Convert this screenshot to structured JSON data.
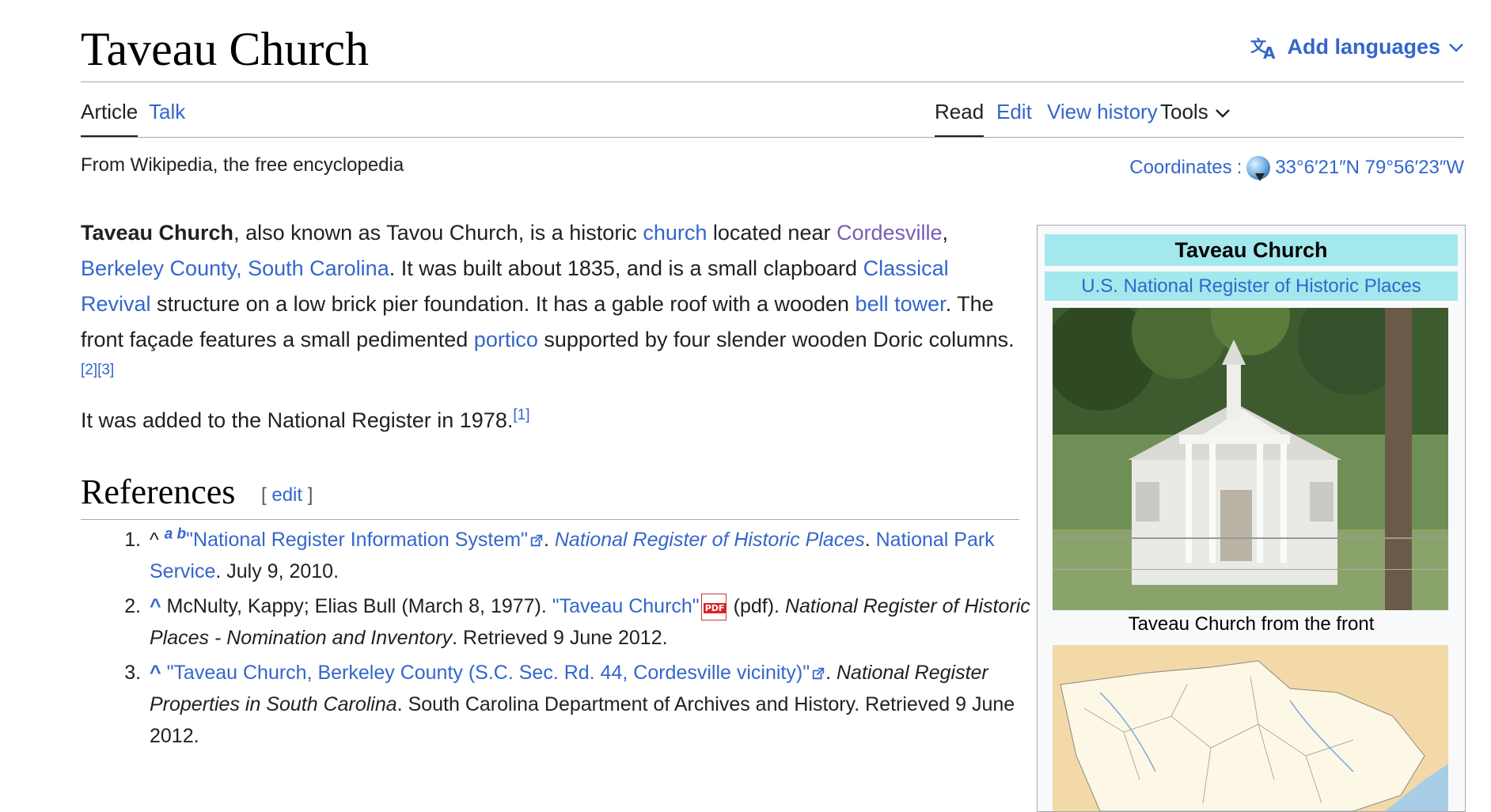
{
  "article": {
    "title": "Taveau Church",
    "add_languages": "Add languages",
    "tagline": "From Wikipedia, the free encyclopedia"
  },
  "tabs": {
    "left": [
      "Article",
      "Talk"
    ],
    "right": [
      "Read",
      "Edit",
      "View history"
    ],
    "tools": "Tools"
  },
  "coordinates": {
    "label": "Coordinates",
    "value": "33°6′21″N 79°56′23″W"
  },
  "intro": {
    "p1": {
      "bold": "Taveau Church",
      "t1": ", also known as Tavou Church, is a historic ",
      "l1": "church",
      "t2": " located near ",
      "l2": "Cordesville",
      "t3": ", ",
      "l3": "Berkeley County, South Carolina",
      "t4": ". It was built about 1835, and is a small clapboard ",
      "l4": "Classical Revival",
      "t5": " structure on a low brick pier foundation. It has a gable roof with a wooden ",
      "l5": "bell tower",
      "t6": ". The front façade features a small pedimented ",
      "l6": "portico",
      "t7": " supported by four slender wooden Doric columns.",
      "sup1": "[2]",
      "sup2": "[3]"
    },
    "p2": {
      "text": "It was added to the National Register in 1978.",
      "sup": "[1]"
    }
  },
  "references": {
    "heading": "References",
    "edit_open": "[ ",
    "edit": "edit",
    "edit_close": " ]",
    "items": [
      {
        "caret": "^",
        "a": "a",
        "b": "b",
        "link": "\"National Register Information System\"",
        "dot1": ". ",
        "italic_link": "National Register of Historic Places",
        "dot2": ". ",
        "link2": "National Park Service",
        "rest": ". July 9, 2010."
      },
      {
        "caret": "^",
        "authors": " McNulty, Kappy; Elias Bull (March 8, 1977). ",
        "link": "\"Taveau Church\"",
        "pdf_icon": "PDF",
        "pdf": " (pdf). ",
        "italic": "National Register of Historic Places - Nomination and Inventory",
        "rest": ". Retrieved 9 June 2012."
      },
      {
        "caret": "^",
        "link": "\"Taveau Church, Berkeley County (S.C. Sec. Rd. 44, Cordesville vicinity)\"",
        "dot1": ". ",
        "italic": "National Register Properties in South Carolina",
        "rest": ". South Carolina Department of Archives and History. Retrieved 9 June 2012."
      }
    ]
  },
  "infobox": {
    "title": "Taveau Church",
    "subtitle": "U.S. National Register of Historic Places",
    "caption": "Taveau Church from the front"
  },
  "colors": {
    "link": "#3366cc",
    "visited": "#795cb2",
    "infobox_header": "#a3e8ec",
    "rule": "#a2a9b1"
  },
  "icons": [
    "translate-icon",
    "chevron-down-icon",
    "globe-icon",
    "external-link-icon",
    "pdf-icon"
  ]
}
